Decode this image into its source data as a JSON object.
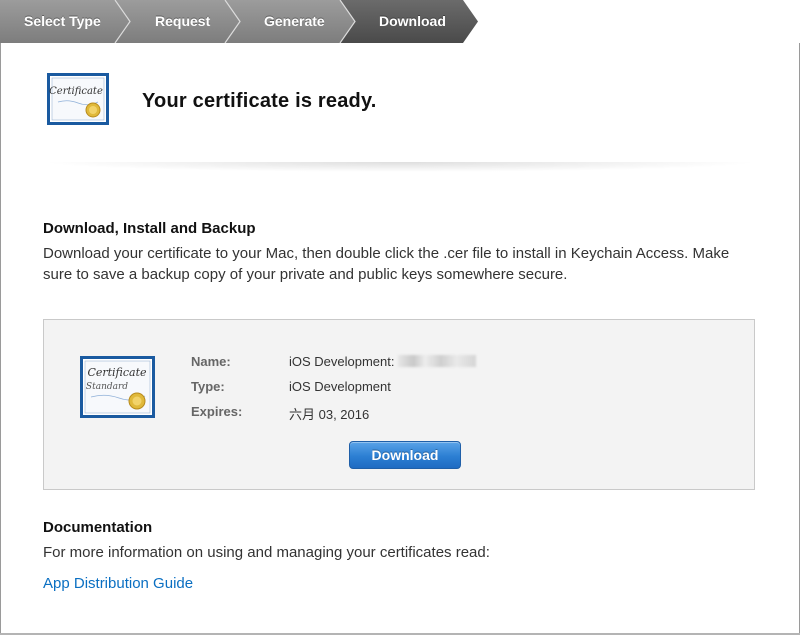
{
  "steps": [
    {
      "label": "Select Type",
      "active": false
    },
    {
      "label": "Request",
      "active": false
    },
    {
      "label": "Generate",
      "active": false
    },
    {
      "label": "Download",
      "active": true
    }
  ],
  "header": {
    "title": "Your certificate is ready.",
    "icon": "certificate-icon",
    "icon_text": "Certificate"
  },
  "download_section": {
    "heading": "Download, Install and Backup",
    "description": "Download your certificate to your Mac, then double click the .cer file to install in Keychain Access. Make sure to save a backup copy of your private and public keys somewhere secure."
  },
  "certificate": {
    "icon": "certificate-standard-icon",
    "icon_text_top": "Certificate",
    "icon_text_bottom": "Standard",
    "name_label": "Name:",
    "name_value": "iOS Development:",
    "type_label": "Type:",
    "type_value": "iOS Development",
    "expires_label": "Expires:",
    "expires_value": "六月 03, 2016",
    "download_label": "Download"
  },
  "documentation": {
    "heading": "Documentation",
    "text": "For more information on using and managing your certificates read:",
    "link_label": "App Distribution Guide"
  },
  "colors": {
    "step_inactive": "#8a8a8a",
    "step_active": "#5b5b5b",
    "link": "#0a6fc2",
    "button": "#2c7fd3"
  }
}
